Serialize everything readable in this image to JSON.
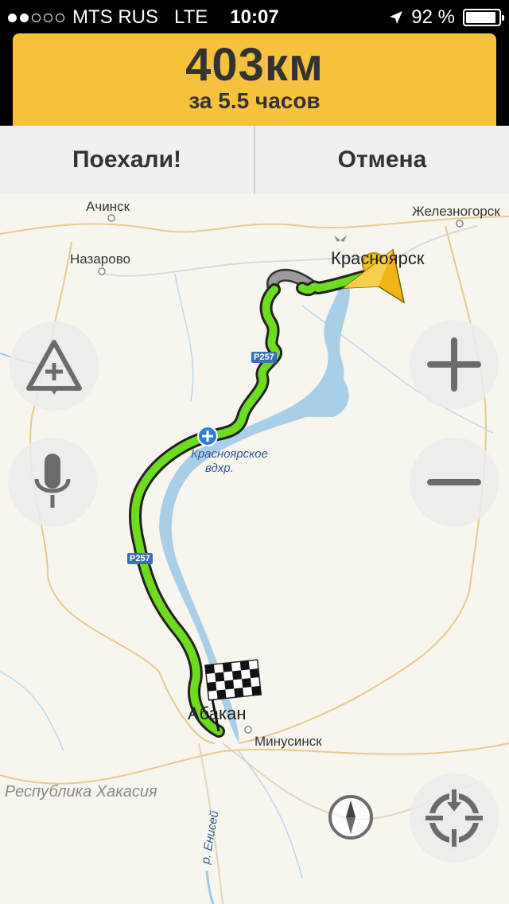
{
  "status": {
    "carrier": "MTS RUS",
    "network": "LTE",
    "time": "10:07",
    "battery_percent": "92 %",
    "battery_level": 0.92
  },
  "route": {
    "distance": "403км",
    "duration": "за 5.5 часов"
  },
  "actions": {
    "go_label": "Поехали!",
    "cancel_label": "Отмена"
  },
  "map": {
    "labels": {
      "achinsk": "Ачинск",
      "zheleznogorsk": "Железногорск",
      "nazarovo": "Назарово",
      "krasnoyarsk": "Красноярск",
      "reservoir_line1": "Красноярское",
      "reservoir_line2": "вдхр.",
      "abakan": "Абакан",
      "minusinsk": "Минусинск",
      "khakassia": "Республика Хакасия",
      "yenisei": "р. Енисей"
    },
    "road_shields": [
      "Р257",
      "Р257"
    ],
    "colors": {
      "route": "#6edc1e",
      "route_jam": "#999999",
      "header": "#f6c23e"
    }
  },
  "controls": {
    "road_event_icon": "road-event-triangle-icon",
    "voice_icon": "microphone-icon",
    "zoom_in_icon": "plus-icon",
    "zoom_out_icon": "minus-icon",
    "compass_icon": "compass-icon",
    "locate_icon": "locate-me-icon"
  }
}
